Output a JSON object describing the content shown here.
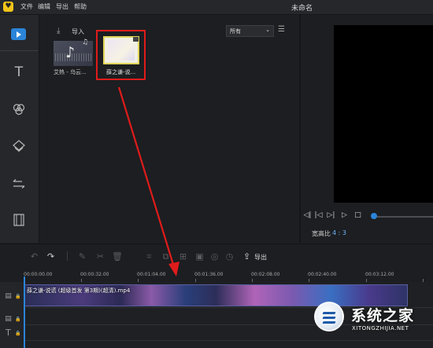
{
  "title_bar": {
    "logo_icon": "app-logo-icon",
    "menu": [
      "文件",
      "编辑",
      "导出",
      "帮助"
    ],
    "app_title": "未命名"
  },
  "sidebar": {
    "items": [
      {
        "name": "media",
        "icon": "play-icon",
        "active": true
      },
      {
        "name": "text",
        "icon": "text-icon"
      },
      {
        "name": "filters",
        "icon": "filter-circles-icon"
      },
      {
        "name": "overlays",
        "icon": "layers-icon"
      },
      {
        "name": "transitions",
        "icon": "transition-arrows-icon"
      },
      {
        "name": "elements",
        "icon": "film-icon"
      }
    ]
  },
  "media_panel": {
    "import_label": "导入",
    "filter_value": "所有",
    "items": [
      {
        "label": "艾热 - 乌云...",
        "type": "audio"
      },
      {
        "label": "薛之谦-说...",
        "type": "video",
        "highlighted": true
      }
    ]
  },
  "preview": {
    "aspect_label": "宽高比",
    "aspect_value": "4 : 3"
  },
  "toolbar": {
    "export_label": "导出"
  },
  "timeline": {
    "ruler": [
      "00:00:00.00",
      "00:00:32.00",
      "00:01:04.00",
      "00:01:36.00",
      "00:02:08.00",
      "00:02:40.00",
      "00:03:12.00"
    ],
    "clip_label": "薛之谦-说谎 (超级首发 第3期)(超清).mp4"
  },
  "watermark": {
    "name": "系统之家",
    "domain": "XITONGZHIJIA.NET"
  },
  "colors": {
    "accent": "#2b84d8",
    "highlight": "#e01b1b"
  }
}
